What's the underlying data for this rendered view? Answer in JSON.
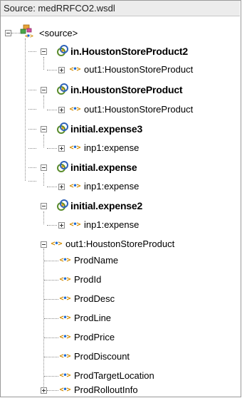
{
  "header": {
    "title": "Source: medRRFCO2.wsdl"
  },
  "tree": {
    "root": {
      "label": "<source>",
      "icon": "source-node-icon"
    },
    "items": [
      {
        "label": "in.HoustonStoreProduct2",
        "icon": "message-part-icon",
        "bold": true
      },
      {
        "label": "out1:HoustonStoreProduct",
        "icon": "element-icon",
        "bold": false
      },
      {
        "label": "in.HoustonStoreProduct",
        "icon": "message-part-icon",
        "bold": true
      },
      {
        "label": "out1:HoustonStoreProduct",
        "icon": "element-icon",
        "bold": false
      },
      {
        "label": "initial.expense3",
        "icon": "message-part-icon",
        "bold": true
      },
      {
        "label": "inp1:expense",
        "icon": "element-icon",
        "bold": false
      },
      {
        "label": "initial.expense",
        "icon": "message-part-icon",
        "bold": true
      },
      {
        "label": "inp1:expense",
        "icon": "element-icon",
        "bold": false
      },
      {
        "label": "initial.expense2",
        "icon": "message-part-icon",
        "bold": true
      },
      {
        "label": "inp1:expense",
        "icon": "element-icon",
        "bold": false
      },
      {
        "label": "out1:HoustonStoreProduct",
        "icon": "element-icon",
        "bold": false
      },
      {
        "label": "ProdName",
        "icon": "element-icon",
        "bold": false
      },
      {
        "label": "ProdId",
        "icon": "element-icon",
        "bold": false
      },
      {
        "label": "ProdDesc",
        "icon": "element-icon",
        "bold": false
      },
      {
        "label": "ProdLine",
        "icon": "element-icon",
        "bold": false
      },
      {
        "label": "ProdPrice",
        "icon": "element-icon",
        "bold": false
      },
      {
        "label": "ProdDiscount",
        "icon": "element-icon",
        "bold": false
      },
      {
        "label": "ProdTargetLocation",
        "icon": "element-icon",
        "bold": false
      },
      {
        "label": "ProdRolloutInfo",
        "icon": "element-icon",
        "bold": false
      }
    ]
  }
}
